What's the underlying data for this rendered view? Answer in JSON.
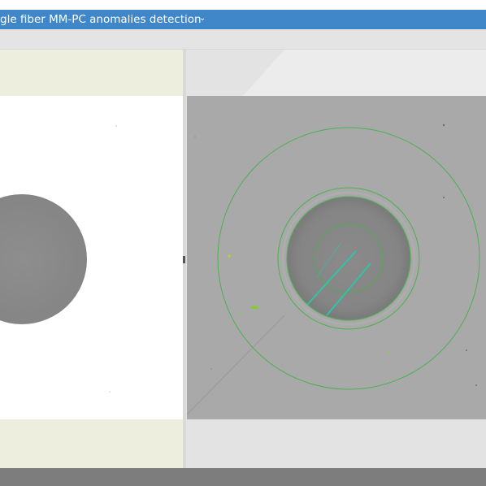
{
  "window": {
    "title": "gle fiber MM-PC anomalies detection",
    "menu_chevron": "⌄"
  },
  "icons": {
    "dropdown": "chevron-down-icon"
  },
  "colors": {
    "titlebar": "#3f87c9",
    "left_panel_bg": "#eeeedf",
    "overlay_green": "#4caf50",
    "defect_cyan": "#2ec4a6"
  }
}
